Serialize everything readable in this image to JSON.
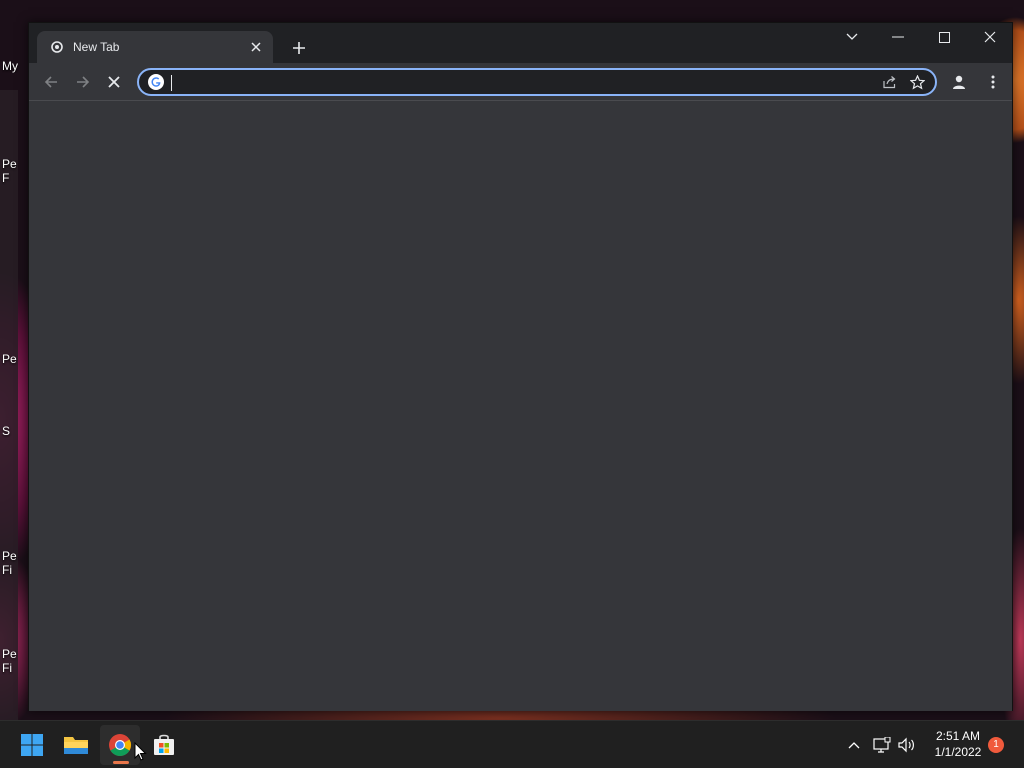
{
  "desktop": {
    "icons": [
      {
        "label": "My"
      },
      {
        "label": "Pe F"
      },
      {
        "label": "Pe"
      },
      {
        "label": "S"
      },
      {
        "label": "Pe Fi"
      },
      {
        "label": "Pe Fi"
      }
    ]
  },
  "browser": {
    "tab": {
      "title": "New Tab",
      "favicon": "chrome-new-tab-icon"
    },
    "omnibox": {
      "value": "",
      "placeholder": ""
    },
    "toolbar": {
      "back": "arrow-left-icon",
      "forward": "arrow-right-icon",
      "stop": "close-icon",
      "share": "share-icon",
      "bookmark": "star-icon",
      "profile": "profile-icon",
      "menu": "more-vertical-icon"
    },
    "colors": {
      "frame": "#202124",
      "toolbar": "#35363a",
      "focus_ring": "#8ab4f8"
    }
  },
  "taskbar": {
    "apps": [
      "start-icon",
      "file-explorer-icon",
      "chrome-icon",
      "microsoft-store-icon"
    ],
    "clock": {
      "time": "2:51 AM",
      "date": "1/1/2022"
    },
    "notification_count": "1"
  }
}
